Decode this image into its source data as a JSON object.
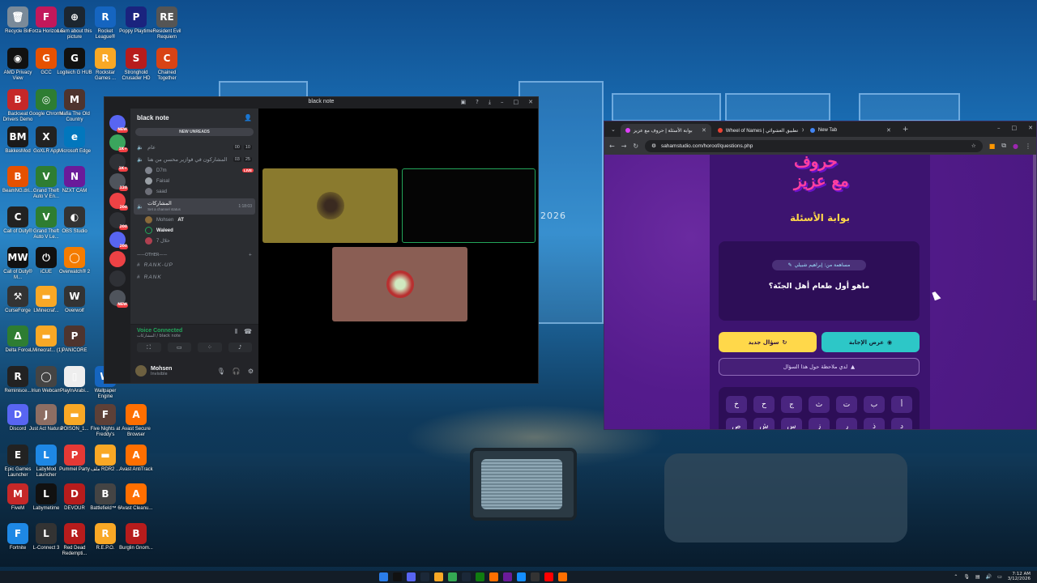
{
  "wallpaper": {
    "year_text": "2026"
  },
  "desktop_icons": [
    {
      "label": "Recycle Bin",
      "icon": "recycle-bin-icon",
      "color": "#7a8a99",
      "glyph": "🗑"
    },
    {
      "label": "Forza Horizon 5",
      "icon": "forza-icon",
      "color": "#c2185b",
      "glyph": "F"
    },
    {
      "label": "Learn about this picture",
      "icon": "camera-icon",
      "color": "#1c2630",
      "glyph": "⊕"
    },
    {
      "label": "Rocket League®",
      "icon": "rocket-league-icon",
      "color": "#1565c0",
      "glyph": "R"
    },
    {
      "label": "Poppy Playtime",
      "icon": "poppy-icon",
      "color": "#1a237e",
      "glyph": "P"
    },
    {
      "label": "Resident Evil Requiem",
      "icon": "resident-evil-icon",
      "color": "#555",
      "glyph": "RE"
    },
    {
      "label": "AMD Privacy View",
      "icon": "amd-icon",
      "color": "#111",
      "glyph": "◉"
    },
    {
      "label": "GCC",
      "icon": "gcc-icon",
      "color": "#e65100",
      "glyph": "G"
    },
    {
      "label": "Logitech G HUB",
      "icon": "logitech-icon",
      "color": "#111",
      "glyph": "G"
    },
    {
      "label": "Rockstar Games ...",
      "icon": "rockstar-icon",
      "color": "#f9a825",
      "glyph": "R"
    },
    {
      "label": "Stronghold Crusader HD",
      "icon": "stronghold-icon",
      "color": "#b71c1c",
      "glyph": "S"
    },
    {
      "label": "Chained Together",
      "icon": "chained-icon",
      "color": "#d84315",
      "glyph": "C"
    },
    {
      "label": "Backseat Drivers Demo",
      "icon": "backseat-icon",
      "color": "#c62828",
      "glyph": "B"
    },
    {
      "label": "Google Chrome",
      "icon": "chrome-icon",
      "color": "#2e7d32",
      "glyph": "◎"
    },
    {
      "label": "Mafia The Old Country",
      "icon": "mafia-icon",
      "color": "#4e342e",
      "glyph": "M"
    },
    {
      "label": "BakkesMod",
      "icon": "bakkesmod-icon",
      "color": "#1a1a1a",
      "glyph": "BM"
    },
    {
      "label": "GoXLR App",
      "icon": "goxlr-icon",
      "color": "#222",
      "glyph": "X"
    },
    {
      "label": "Microsoft Edge",
      "icon": "edge-icon",
      "color": "#0277bd",
      "glyph": "e"
    },
    {
      "label": "BeamNG.dri...",
      "icon": "beamng-icon",
      "color": "#e65100",
      "glyph": "B"
    },
    {
      "label": "Grand Theft Auto V En...",
      "icon": "gta-icon",
      "color": "#2e7d32",
      "glyph": "V"
    },
    {
      "label": "NZXT CAM",
      "icon": "nzxt-icon",
      "color": "#6a1b9a",
      "glyph": "N"
    },
    {
      "label": "Call of Duty®",
      "icon": "cod-icon",
      "color": "#222",
      "glyph": "C"
    },
    {
      "label": "Grand Theft Auto V Le...",
      "icon": "gta-legacy-icon",
      "color": "#2e7d32",
      "glyph": "V"
    },
    {
      "label": "OBS Studio",
      "icon": "obs-icon",
      "color": "#333",
      "glyph": "◐"
    },
    {
      "label": "Call of Duty® M...",
      "icon": "cod-mw-icon",
      "color": "#111",
      "glyph": "MW"
    },
    {
      "label": "iCUE",
      "icon": "icue-icon",
      "color": "#111",
      "glyph": "⏻"
    },
    {
      "label": "Overwatch® 2",
      "icon": "overwatch-icon",
      "color": "#f57c00",
      "glyph": "◯"
    },
    {
      "label": "CurseForge",
      "icon": "curseforge-icon",
      "color": "#333",
      "glyph": "⚒"
    },
    {
      "label": "LMinecraf...",
      "icon": "folder-icon",
      "color": "#f9a825",
      "glyph": "▬"
    },
    {
      "label": "Overwolf",
      "icon": "overwolf-icon",
      "color": "#333",
      "glyph": "W"
    },
    {
      "label": "Delta Force",
      "icon": "delta-force-icon",
      "color": "#2e7d32",
      "glyph": "Δ"
    },
    {
      "label": "LMinecraf... (1)",
      "icon": "folder-icon-2",
      "color": "#f9a825",
      "glyph": "▬"
    },
    {
      "label": "PANICORE",
      "icon": "panicore-icon",
      "color": "#4e342e",
      "glyph": "P"
    },
    {
      "label": "Reminisce...",
      "icon": "reminisce-icon",
      "color": "#222",
      "glyph": "R"
    },
    {
      "label": "Iriun Webcam",
      "icon": "webcam-icon",
      "color": "#444",
      "glyph": "◯"
    },
    {
      "label": "PlayInArabi...",
      "icon": "file-icon",
      "color": "#eee",
      "glyph": "▯"
    },
    {
      "label": "Wallpaper Engine",
      "icon": "wallpaper-engine-icon",
      "color": "#1565c0",
      "glyph": "W"
    },
    {
      "label": "Discord",
      "icon": "discord-icon",
      "color": "#5865f2",
      "glyph": "D"
    },
    {
      "label": "Just Act Natural",
      "icon": "jan-icon",
      "color": "#8d6e63",
      "glyph": "J"
    },
    {
      "label": "POISON_1...",
      "icon": "folder-icon-3",
      "color": "#f9a825",
      "glyph": "▬"
    },
    {
      "label": "Five Nights at Freddy's",
      "icon": "fnaf-icon",
      "color": "#5d4037",
      "glyph": "F"
    },
    {
      "label": "Avast Secure Browser",
      "icon": "avast-browser-icon",
      "color": "#ff6f00",
      "glyph": "A"
    },
    {
      "label": "Epic Games Launcher",
      "icon": "epic-icon",
      "color": "#222",
      "glyph": "E"
    },
    {
      "label": "LabyMod Launcher",
      "icon": "labymod-icon",
      "color": "#1e88e5",
      "glyph": "L"
    },
    {
      "label": "Pummel Party",
      "icon": "pummel-icon",
      "color": "#e53935",
      "glyph": "P"
    },
    {
      "label": "ملف RDR2 ...",
      "icon": "folder-icon-4",
      "color": "#f9a825",
      "glyph": "▬"
    },
    {
      "label": "Avast AntiTrack",
      "icon": "avast-antitrack-icon",
      "color": "#ff6f00",
      "glyph": "A"
    },
    {
      "label": "FiveM",
      "icon": "fivem-icon",
      "color": "#c62828",
      "glyph": "M"
    },
    {
      "label": "Labymetime",
      "icon": "labymetime-icon",
      "color": "#111",
      "glyph": "L"
    },
    {
      "label": "DEVOUR",
      "icon": "devour-icon",
      "color": "#b71c1c",
      "glyph": "D"
    },
    {
      "label": "Battlefield™ 6",
      "icon": "battlefield-icon",
      "color": "#444",
      "glyph": "B"
    },
    {
      "label": "Avast Cleanu...",
      "icon": "avast-cleanup-icon",
      "color": "#ff6f00",
      "glyph": "A"
    },
    {
      "label": "Fortnite",
      "icon": "fortnite-icon",
      "color": "#1e88e5",
      "glyph": "F"
    },
    {
      "label": "L-Connect 3",
      "icon": "lconnect-icon",
      "color": "#333",
      "glyph": "L"
    },
    {
      "label": "Red Dead Redempti...",
      "icon": "rdr-icon",
      "color": "#b71c1c",
      "glyph": "R"
    },
    {
      "label": "R.E.P.O.",
      "icon": "repo-icon",
      "color": "#f9a825",
      "glyph": "R"
    },
    {
      "label": "Burglin Gnom...",
      "icon": "burglin-icon",
      "color": "#b71c1c",
      "glyph": "B"
    }
  ],
  "discord": {
    "window_title": "black note",
    "server_name": "black note",
    "new_unreads": "NEW UNREADS",
    "server_badges": [
      "NEW",
      "1K+",
      "1K+",
      "120",
      "200",
      "200",
      "200",
      "NEW"
    ],
    "channels": [
      {
        "name": "عام",
        "counts": [
          "00",
          "10"
        ],
        "icon": "speaker-icon"
      },
      {
        "name": "المشاركون في فوازير محسن من هنا",
        "counts": [
          "03",
          "25"
        ],
        "icon": "speaker-icon"
      }
    ],
    "voice_users_1": [
      {
        "name": "D7m",
        "live": "LIVE"
      },
      {
        "name": "Faisal",
        "live": ""
      },
      {
        "name": "saad",
        "live": ""
      }
    ],
    "active_channel": {
      "name": "المشاركات",
      "time": "1:18:03",
      "status": "Set a channel status"
    },
    "voice_users_2": [
      {
        "name": "Mohsen",
        "tag": "AT"
      },
      {
        "name": "Waleed",
        "tag": ""
      },
      {
        "name": "خلال 7",
        "tag": ""
      }
    ],
    "other_category": "OTHER",
    "text_channels": [
      "RANK-UP",
      "RANK"
    ],
    "voice_connected": "Voice Connected",
    "voice_sub": "المشاركات / black note",
    "user_name": "Mohsen",
    "user_status": "Invisible"
  },
  "chrome": {
    "tabs": [
      {
        "label": "بوابة الأسئلة | حروف مع عزيز",
        "fav": "#e040fb"
      },
      {
        "label": "Wheel of Names | تطبيق العشوائي",
        "fav": "#ea4335"
      },
      {
        "label": "New Tab",
        "fav": "#4285f4"
      }
    ],
    "url": "sahamstudio.com/horoof/questions.php",
    "logo_text": "حروف مع عزيز",
    "page_title": "بوابة الأسئلة",
    "contributor": "مساهمة من: إبراهيم شبيلي",
    "question": "ماهو أول طعام أهل الجنّة؟",
    "new_question_label": "سؤال جديد",
    "show_answer_label": "عرض الإجابة",
    "note_label": "لدي ملاحظة حول هذا السؤال",
    "keyboard_row1": [
      "خ",
      "ح",
      "ج",
      "ث",
      "ت",
      "ب",
      "أ"
    ],
    "keyboard_row2": [
      "ص",
      "ش",
      "س",
      "ز",
      "ر",
      "ذ",
      "د"
    ]
  },
  "taskbar": {
    "time": "7:12 AM",
    "date": "3/12/2026",
    "apps": [
      "windows-icon",
      "capcut-icon",
      "discord-icon",
      "steam-icon",
      "folder-icon",
      "chrome-icon",
      "steam-alt-icon",
      "xbox-icon",
      "avast-icon",
      "nzxt-icon",
      "battlenet-icon",
      "obs-icon",
      "youtube-icon",
      "avast-browser-icon"
    ]
  }
}
